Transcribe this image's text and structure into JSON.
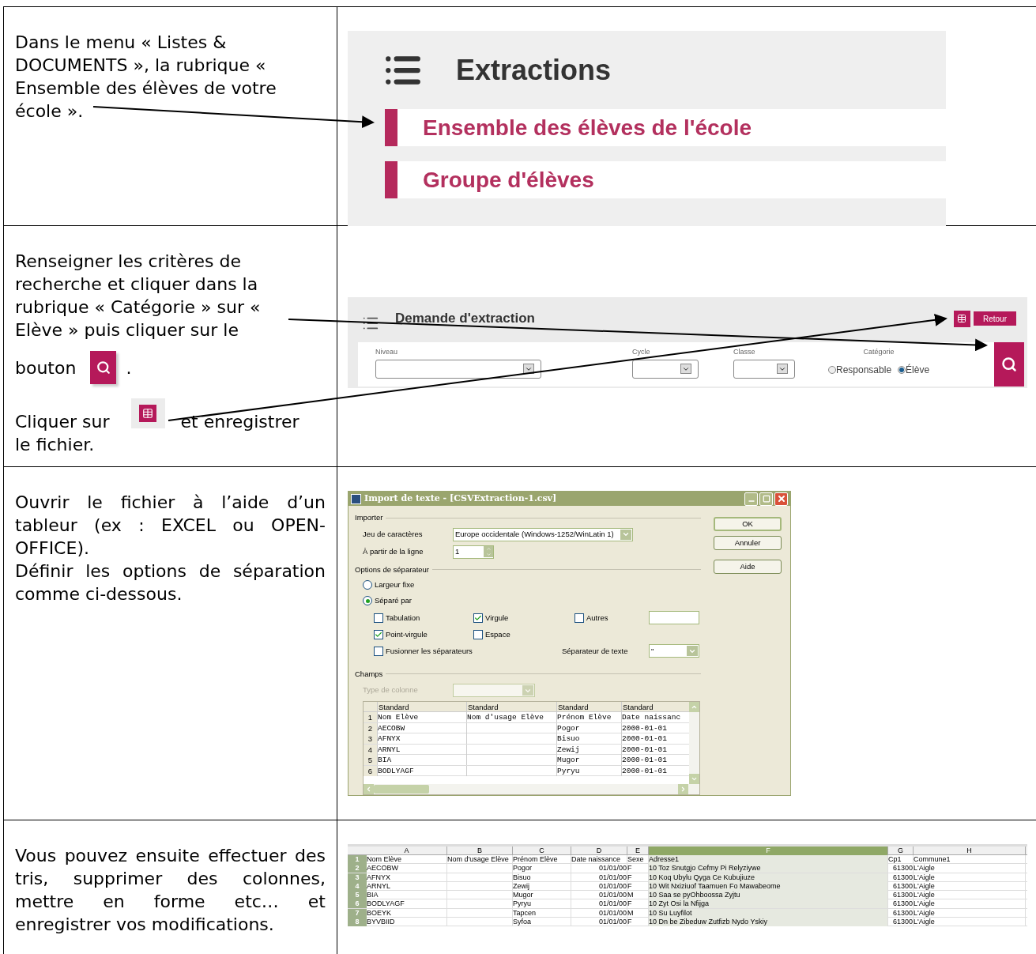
{
  "step1": {
    "text": "Dans le menu « Listes & DOCUMENTS », la rubrique « Ensemble  des élèves de votre",
    "text_end": "école ».",
    "menu": {
      "title": "Extractions",
      "items": [
        {
          "label": "Ensemble des élèves de l'école"
        },
        {
          "label": "Groupe d'élèves"
        }
      ]
    }
  },
  "step2": {
    "text_search": "Renseigner les critères de recherche et cliquer dans la rubrique « Catégorie » sur « Elève » puis cliquer sur le",
    "text_button": "bouton",
    "text_search_end": ".",
    "text_export": "Cliquer sur",
    "text_export_end": "et enregistrer",
    "text_export_last": "le fichier.",
    "form": {
      "title": "Demande d'extraction",
      "back_button": "Retour",
      "fields": [
        {
          "label": "Niveau",
          "kind": "select"
        },
        {
          "label": "Cycle",
          "kind": "select"
        },
        {
          "label": "Classe",
          "kind": "select"
        }
      ],
      "category": {
        "label": "Catégorie",
        "options": [
          {
            "label": "Responsable",
            "selected": false
          },
          {
            "label": "Élève",
            "selected": true
          }
        ]
      }
    }
  },
  "step3": {
    "paragraphs": [
      "Ouvrir le fichier à l’aide d’un tableur (ex : EXCEL ou OPEN-OFFICE).",
      "Définir les options de séparation comme ci-dessous."
    ],
    "dialog": {
      "title": "Import de texte - [CSVExtraction-1.csv]",
      "buttons": [
        "OK",
        "Annuler",
        "Aide"
      ],
      "import_section": "Importer",
      "charset_label": "Jeu de caractères",
      "charset_value": "Europe occidentale (Windows-1252/WinLatin 1)",
      "from_line_label": "À partir de la ligne",
      "from_line_value": "1",
      "separator_section": "Options de séparateur",
      "modes": [
        {
          "label": "Largeur fixe",
          "selected": false
        },
        {
          "label": "Séparé par",
          "selected": true
        }
      ],
      "separators": [
        {
          "label": "Tabulation",
          "checked": false
        },
        {
          "label": "Virgule",
          "checked": true
        },
        {
          "label": "Autres",
          "checked": false
        },
        {
          "label": "Point-virgule",
          "checked": true
        },
        {
          "label": "Espace",
          "checked": false
        }
      ],
      "merge": {
        "label": "Fusionner les séparateurs",
        "checked": false
      },
      "text_separator_label": "Séparateur de texte",
      "text_separator_value": "\"",
      "fields_section": "Champs",
      "column_type_label": "Type de colonne",
      "column_type_disabled": true,
      "preview": {
        "headers": [
          "Standard",
          "Standard",
          "Standard",
          "Standard"
        ],
        "rows": [
          {
            "number": "1",
            "cells": [
              "Nom Elève",
              "Nom d'usage Elève",
              "Prénom Elève",
              "Date naissanc"
            ]
          },
          {
            "number": "2",
            "cells": [
              "AECOBW",
              "",
              "Pogor",
              "2000-01-01"
            ]
          },
          {
            "number": "3",
            "cells": [
              "AFNYX",
              "",
              "Bisuo",
              "2000-01-01"
            ]
          },
          {
            "number": "4",
            "cells": [
              "ARNYL",
              "",
              "Zewij",
              "2000-01-01"
            ]
          },
          {
            "number": "5",
            "cells": [
              "BIA",
              "",
              "Mugor",
              "2000-01-01"
            ]
          },
          {
            "number": "6",
            "cells": [
              "BODLYAGF",
              "",
              "Pyryu",
              "2000-01-01"
            ]
          }
        ]
      }
    }
  },
  "step4": {
    "text": "Vous pouvez ensuite effectuer des tris, supprimer des colonnes, mettre en forme etc… et enregistrer vos modifications.",
    "sheet": {
      "columns": [
        {
          "label": "A",
          "selected": false
        },
        {
          "label": "B",
          "selected": false
        },
        {
          "label": "C",
          "selected": false
        },
        {
          "label": "D",
          "selected": false
        },
        {
          "label": "E",
          "selected": false
        },
        {
          "label": "F",
          "selected": true
        },
        {
          "label": "G",
          "selected": false
        },
        {
          "label": "H",
          "selected": false
        }
      ],
      "rows": [
        {
          "number": "1",
          "cells": [
            "Nom Elève",
            "Nom d'usage Elève",
            "Prénom Elève",
            "Date naissance",
            "Sexe",
            "Adresse1",
            "Cp1",
            "Commune1"
          ]
        },
        {
          "number": "2",
          "cells": [
            "AECOBW",
            "",
            "Pogor",
            "01/01/00",
            "F",
            "10 Toz Snutgjo Cefmy Pi Relyziywe",
            "61300",
            "L'Aigle"
          ]
        },
        {
          "number": "3",
          "cells": [
            "AFNYX",
            "",
            "Bisuo",
            "01/01/00",
            "F",
            "10 Koq Ubylu Qyga Ce Kubujiuze",
            "61300",
            "L'Aigle"
          ]
        },
        {
          "number": "4",
          "cells": [
            "ARNYL",
            "",
            "Zewij",
            "01/01/00",
            "F",
            "10 Wit Nxiziuof Taamuen Fo Mawabeome",
            "61300",
            "L'Aigle"
          ]
        },
        {
          "number": "5",
          "cells": [
            "BIA",
            "",
            "Mugor",
            "01/01/00",
            "M",
            "10 Saa se pyOhboossa Zyjtu",
            "61300",
            "L'Aigle"
          ]
        },
        {
          "number": "6",
          "cells": [
            "BODLYAGF",
            "",
            "Pyryu",
            "01/01/00",
            "F",
            "10 Zyt Osi la Nfijga",
            "61300",
            "L'Aigle"
          ]
        },
        {
          "number": "7",
          "cells": [
            "BOEYK",
            "",
            "Tapcen",
            "01/01/00",
            "M",
            "10 Su Luyfilot",
            "61300",
            "L'Aigle"
          ]
        },
        {
          "number": "8",
          "cells": [
            "BYVBIID",
            "",
            "Syfoa",
            "01/01/00",
            "F",
            "10 Dn be Zibeduw Zutfizb Nydo Yskiy",
            "61300",
            "L'Aigle"
          ]
        }
      ]
    }
  }
}
